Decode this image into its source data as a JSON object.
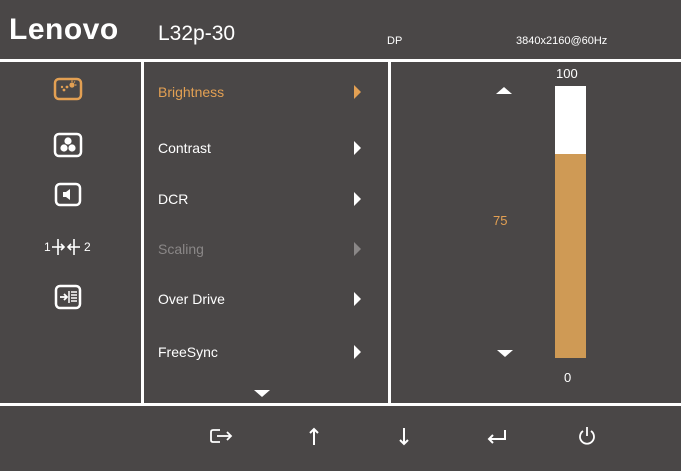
{
  "header": {
    "brand": "Lenovo",
    "model": "L32p-30",
    "input_source": "DP",
    "resolution": "3840x2160@60Hz"
  },
  "categories": [
    {
      "icon": "brightness-icon",
      "selected": true
    },
    {
      "icon": "color-icon",
      "selected": false
    },
    {
      "icon": "audio-icon",
      "selected": false
    },
    {
      "icon": "input-select-icon",
      "selected": false
    },
    {
      "icon": "menu-settings-icon",
      "selected": false
    }
  ],
  "menu": {
    "items": [
      {
        "label": "Brightness",
        "state": "selected"
      },
      {
        "label": "Contrast",
        "state": "normal"
      },
      {
        "label": "DCR",
        "state": "normal"
      },
      {
        "label": "Scaling",
        "state": "disabled"
      },
      {
        "label": "Over Drive",
        "state": "normal"
      },
      {
        "label": "FreeSync",
        "state": "normal"
      }
    ]
  },
  "slider": {
    "max_label": "100",
    "min_label": "0",
    "current_label": "75",
    "level_fraction": 0.75
  },
  "footer": {
    "buttons": [
      "exit-icon",
      "up-arrow-icon",
      "down-arrow-icon",
      "enter-icon",
      "power-icon"
    ]
  },
  "colors": {
    "background": "#4a4747",
    "accent": "#e3a053",
    "bar_fill": "#cf9a55",
    "disabled_text": "#8a8787"
  }
}
